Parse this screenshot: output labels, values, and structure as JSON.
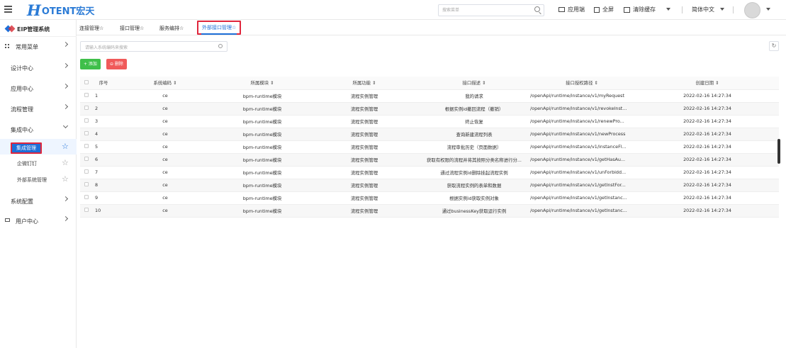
{
  "header": {
    "logo_mark": "H",
    "logo_text": "OTENT宏天",
    "search_placeholder": "搜索菜单",
    "actions": {
      "app_side": "应用端",
      "fullscreen": "全屏",
      "clear_cache": "清除缓存"
    },
    "language": "简体中文"
  },
  "sidebar": {
    "system": "EIP管理系统",
    "menus": [
      {
        "label": "常用菜单"
      },
      {
        "label": "设计中心"
      },
      {
        "label": "应用中心"
      },
      {
        "label": "流程管理"
      },
      {
        "label": "集成中心"
      }
    ],
    "submenus": [
      {
        "label": "集成管理"
      },
      {
        "label": "企微钉钉"
      },
      {
        "label": "外部系统管理"
      }
    ],
    "menus2": [
      {
        "label": "系统配置"
      },
      {
        "label": "用户中心"
      }
    ]
  },
  "tabs": [
    {
      "label": "连接管理☆"
    },
    {
      "label": "接口管理☆"
    },
    {
      "label": "服务编排☆"
    },
    {
      "label": "外部接口管理☆"
    }
  ],
  "toolbar": {
    "search_placeholder": "请输入系统编码来搜索",
    "add_label": "+ 添加",
    "delete_label": "⊖ 删除",
    "refresh_icon": "↻"
  },
  "table": {
    "headers": [
      "序号",
      "系统编码 ⇕",
      "所属模块 ⇕",
      "所属功能 ⇕",
      "接口描述 ⇕",
      "接口授权路径 ⇕",
      "创建日期 ⇕"
    ],
    "rows": [
      [
        "1",
        "ce",
        "bpm-runtime模块",
        "流程实例管理",
        "我的请求",
        "/openApi/runtime/instance/v1/myRequest",
        "2022-02-16 14:27:34"
      ],
      [
        "2",
        "ce",
        "bpm-runtime模块",
        "流程实例管理",
        "根据实例id撤回流程（撤销）",
        "/openApi/runtime/instance/v1/revokeInst...",
        "2022-02-16 14:27:34"
      ],
      [
        "3",
        "ce",
        "bpm-runtime模块",
        "流程实例管理",
        "终止恢复",
        "/openApi/runtime/instance/v1/renewPro...",
        "2022-02-16 14:27:34"
      ],
      [
        "4",
        "ce",
        "bpm-runtime模块",
        "流程实例管理",
        "查询新建流程列表",
        "/openApi/runtime/instance/v1/newProcess",
        "2022-02-16 14:27:34"
      ],
      [
        "5",
        "ce",
        "bpm-runtime模块",
        "流程实例管理",
        "流程审批历史（页面数据）",
        "/openApi/runtime/instance/v1/instanceFl...",
        "2022-02-16 14:27:34"
      ],
      [
        "6",
        "ce",
        "bpm-runtime模块",
        "流程实例管理",
        "获取有权限的流程并将其按照分类名称进行分...",
        "/openApi/runtime/instance/v1/getHasAu...",
        "2022-02-16 14:27:34"
      ],
      [
        "7",
        "ce",
        "bpm-runtime模块",
        "流程实例管理",
        "通过流程实例id删除挂起流程实例",
        "/openApi/runtime/instance/v1/unForbidd...",
        "2022-02-16 14:27:34"
      ],
      [
        "8",
        "ce",
        "bpm-runtime模块",
        "流程实例管理",
        "获取流程实例的表单和数据",
        "/openApi/runtime/instance/v1/getInstFor...",
        "2022-02-16 14:27:34"
      ],
      [
        "9",
        "ce",
        "bpm-runtime模块",
        "流程实例管理",
        "根据实例id获取实例对象",
        "/openApi/runtime/instance/v1/getInstanc...",
        "2022-02-16 14:27:34"
      ],
      [
        "10",
        "ce",
        "bpm-runtime模块",
        "流程实例管理",
        "通过businessKey获取运行实例",
        "/openApi/runtime/instance/v1/getInstanc...",
        "2022-02-16 14:27:34"
      ]
    ]
  }
}
